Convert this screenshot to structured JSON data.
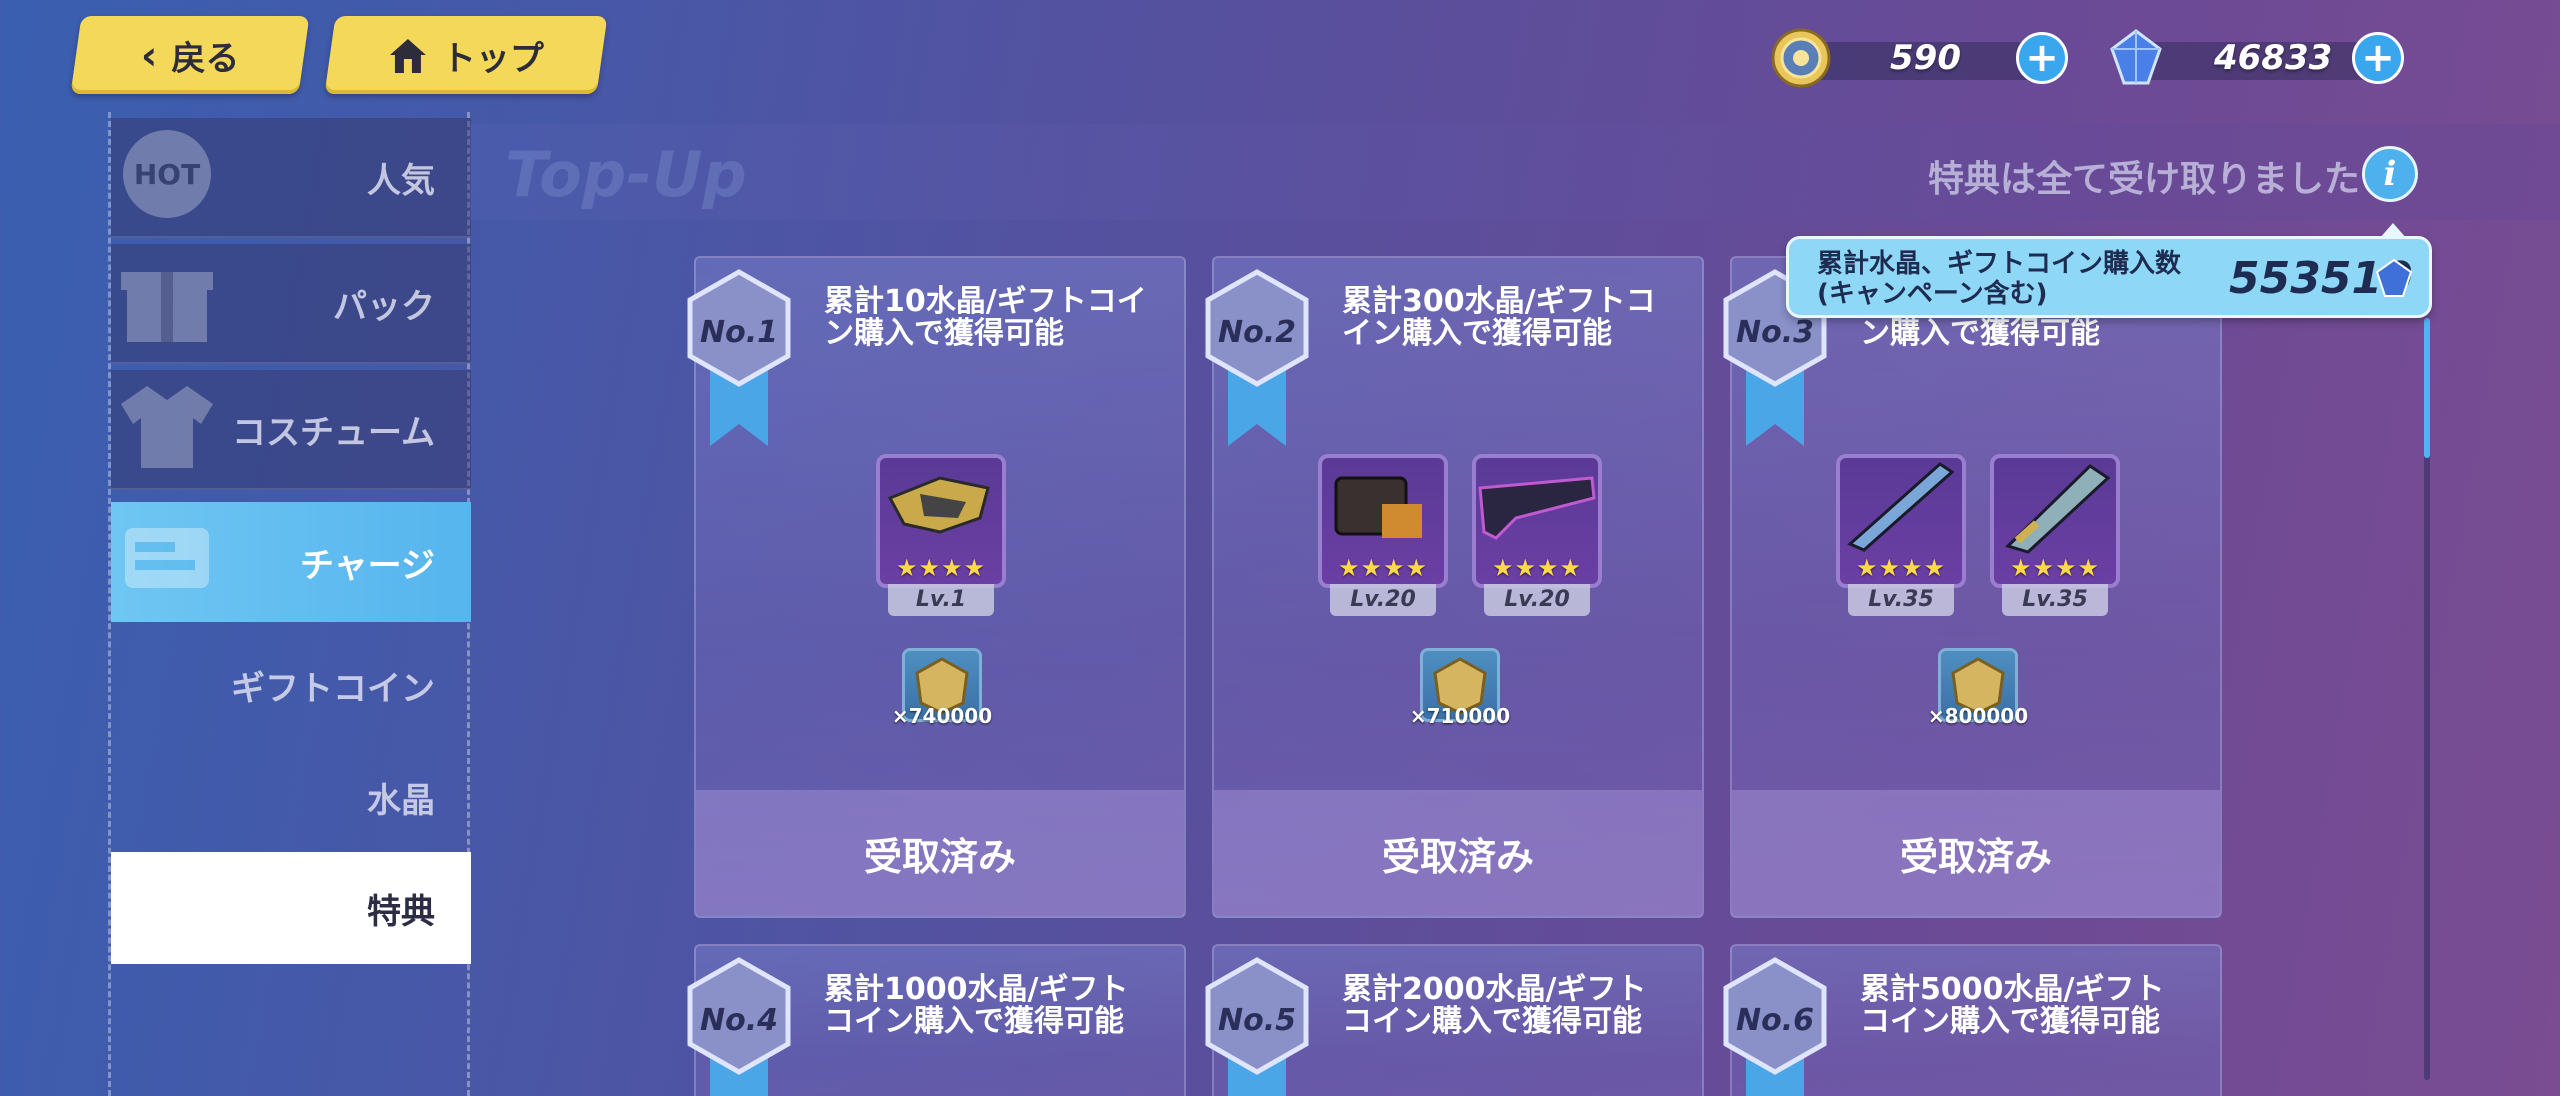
{
  "nav": {
    "back_label": "戻る",
    "top_label": "トップ"
  },
  "currency": {
    "coins": "590",
    "crystals": "46833"
  },
  "sidebar": {
    "items": [
      {
        "label": "人気",
        "icon": "hot-icon"
      },
      {
        "label": "パック",
        "icon": "gift-icon"
      },
      {
        "label": "コスチューム",
        "icon": "costume-icon"
      },
      {
        "label": "チャージ",
        "icon": "charge-icon"
      },
      {
        "label": "ギフトコイン"
      },
      {
        "label": "水晶"
      },
      {
        "label": "特典"
      }
    ]
  },
  "header": {
    "watermark": "Top-Up",
    "claimed_note": "特典は全て受け取りました",
    "info_glyph": "i"
  },
  "tooltip": {
    "label_line1": "累計水晶、ギフトコイン購入数",
    "label_line2": "(キャンペーン含む)",
    "value": "553510"
  },
  "cards": [
    {
      "no": "No.1",
      "title": "累計10水晶/ギフトコイン購入で獲得可能",
      "items": [
        {
          "level": "Lv.1",
          "stars": "★★★★"
        }
      ],
      "coin_qty": "×740000",
      "status": "受取済み"
    },
    {
      "no": "No.2",
      "title": "累計300水晶/ギフトコイン購入で獲得可能",
      "items": [
        {
          "level": "Lv.20",
          "stars": "★★★★"
        },
        {
          "level": "Lv.20",
          "stars": "★★★★"
        }
      ],
      "coin_qty": "×710000",
      "status": "受取済み"
    },
    {
      "no": "No.3",
      "title": "ン購入で獲得可能",
      "items": [
        {
          "level": "Lv.35",
          "stars": "★★★★"
        },
        {
          "level": "Lv.35",
          "stars": "★★★★"
        }
      ],
      "coin_qty": "×800000",
      "status": "受取済み"
    },
    {
      "no": "No.4",
      "title": "累計1000水晶/ギフトコイン購入で獲得可能"
    },
    {
      "no": "No.5",
      "title": "累計2000水晶/ギフトコイン購入で獲得可能"
    },
    {
      "no": "No.6",
      "title": "累計5000水晶/ギフトコイン購入で獲得可能"
    }
  ],
  "colors": {
    "accent_yellow": "#f4d85a",
    "accent_blue": "#4fb0ee",
    "selected_tab": "#56b5ee"
  }
}
